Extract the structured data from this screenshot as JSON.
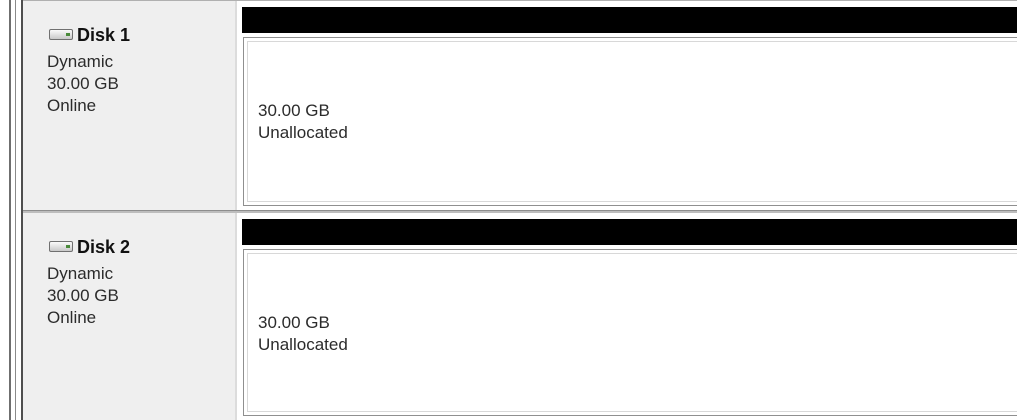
{
  "disks": [
    {
      "name": "Disk 1",
      "type": "Dynamic",
      "capacity": "30.00 GB",
      "status": "Online",
      "volume": {
        "size": "30.00 GB",
        "state": "Unallocated",
        "bar_color": "#000000"
      }
    },
    {
      "name": "Disk 2",
      "type": "Dynamic",
      "capacity": "30.00 GB",
      "status": "Online",
      "volume": {
        "size": "30.00 GB",
        "state": "Unallocated",
        "bar_color": "#000000"
      }
    }
  ],
  "icons": {
    "disk": "hard-disk-icon"
  },
  "colors": {
    "label_pane_bg": "#efefef",
    "unallocated_bar": "#000000"
  }
}
